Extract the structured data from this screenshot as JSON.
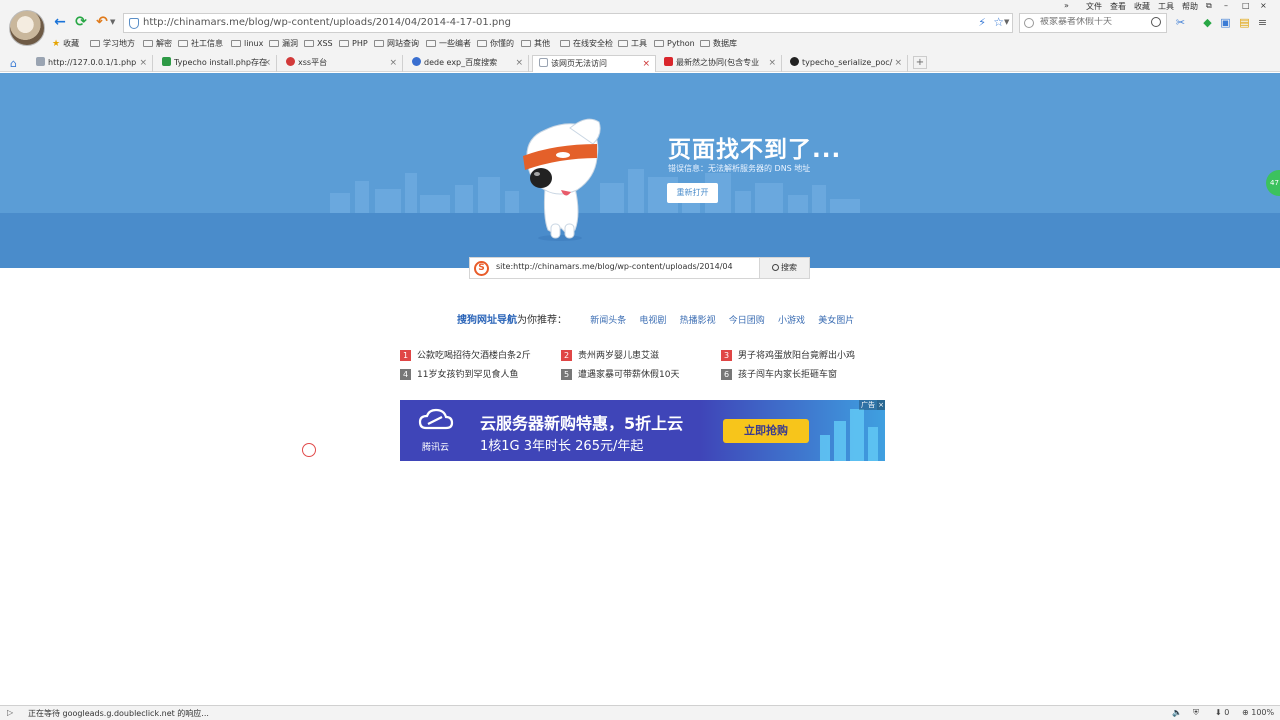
{
  "browser": {
    "url": "http://chinamars.me/blog/wp-content/uploads/2014/04/2014-4-17-01.png",
    "search_placeholder": "被家暴者休假十天",
    "menu": [
      "文件",
      "查看",
      "收藏",
      "工具",
      "帮助"
    ],
    "menu_more": "»"
  },
  "bookmarks": [
    "收藏",
    "学习地方",
    "解密",
    "社工信息",
    "linux",
    "漏洞",
    "XSS",
    "PHP",
    "网站查询",
    "一些编者",
    "你懂的",
    "其他",
    "在线安全检",
    "工具",
    "Python",
    "数据库"
  ],
  "tabs": [
    {
      "title": "http://127.0.0.1/1.php",
      "favicon_color": "#9aa4b2"
    },
    {
      "title": "Typecho install.php存在",
      "favicon_color": "#2e9a46"
    },
    {
      "title": "xss平台",
      "favicon_color": "#d23a3a"
    },
    {
      "title": "dede exp_百度搜索",
      "favicon_color": "#3a6fd0"
    },
    {
      "title": "该网页无法访问",
      "favicon_color": "#9aa4b2"
    },
    {
      "title": "最新然之协同(包含专业",
      "favicon_color": "#d9262c"
    },
    {
      "title": "typecho_serialize_poc/",
      "favicon_color": "#222222"
    }
  ],
  "new_tab_label": "+",
  "error_page": {
    "title": "页面找不到了...",
    "detail": "错误信息：无法解析服务器的 DNS 地址",
    "reopen_label": "重新打开"
  },
  "site_search": {
    "logo": "S",
    "query": "site:http://chinamars.me/blog/wp-content/uploads/2014/04",
    "button_label": "搜索"
  },
  "recommend": {
    "brand": "搜狗网址导航",
    "suffix": "为你推荐：",
    "links": [
      "新闻头条",
      "电视剧",
      "热播影视",
      "今日团购",
      "小游戏",
      "美女图片"
    ]
  },
  "news": [
    {
      "rank": "1",
      "text": "公款吃喝招待欠酒楼白条2斤",
      "hot": true
    },
    {
      "rank": "2",
      "text": "贵州两岁婴儿患艾滋",
      "hot": true
    },
    {
      "rank": "3",
      "text": "男子将鸡蛋放阳台竟孵出小鸡",
      "hot": true
    },
    {
      "rank": "4",
      "text": "11岁女孩钓到罕见食人鱼",
      "hot": false
    },
    {
      "rank": "5",
      "text": "遭遇家暴可带薪休假10天",
      "hot": false
    },
    {
      "rank": "6",
      "text": "孩子闯车内家长拒砸车窗",
      "hot": false
    }
  ],
  "ad": {
    "brand": "腾讯云",
    "line1": "云服务器新购特惠，5折上云",
    "line2": "1核1G 3年时长 265元/年起",
    "cta": "立即抢购",
    "label": "广告",
    "close": "×"
  },
  "side_widget": "47",
  "status": {
    "text": "正在等待 googleads.g.doubleclick.net 的响应...",
    "download_count": "0",
    "zoom": "100%"
  }
}
